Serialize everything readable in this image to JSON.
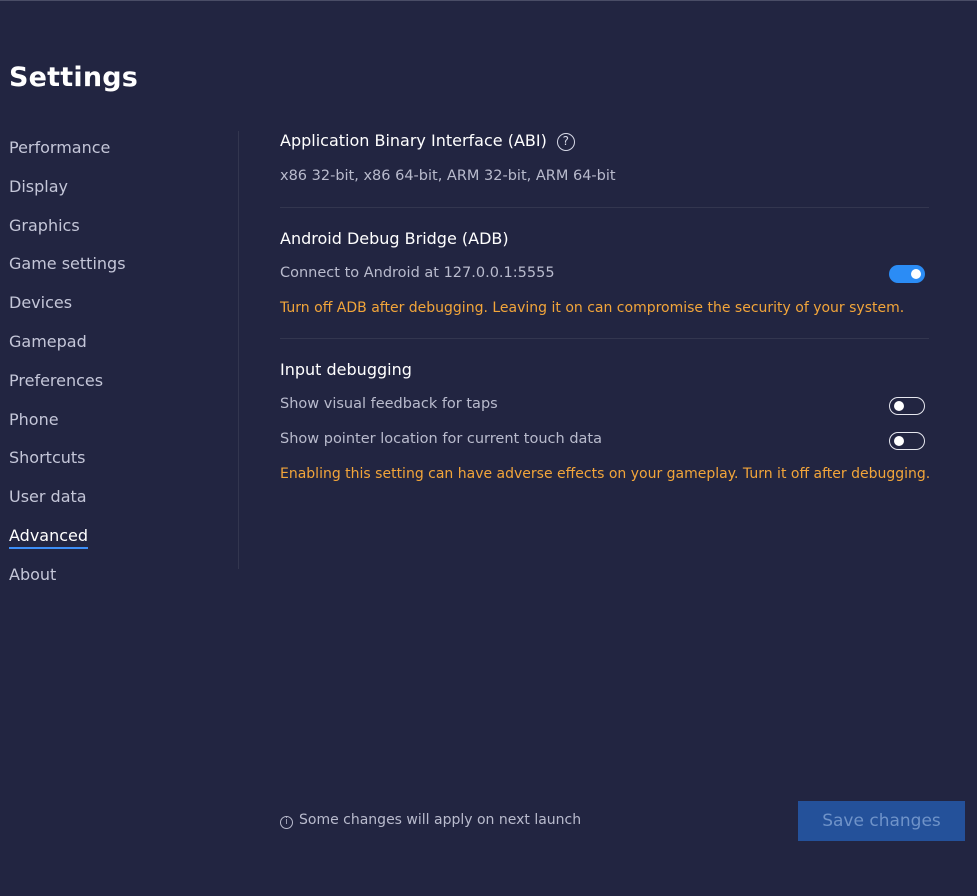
{
  "page": {
    "title": "Settings"
  },
  "sidebar": {
    "items": [
      {
        "label": "Performance"
      },
      {
        "label": "Display"
      },
      {
        "label": "Graphics"
      },
      {
        "label": "Game settings"
      },
      {
        "label": "Devices"
      },
      {
        "label": "Gamepad"
      },
      {
        "label": "Preferences"
      },
      {
        "label": "Phone"
      },
      {
        "label": "Shortcuts"
      },
      {
        "label": "User data"
      },
      {
        "label": "Advanced",
        "active": true
      },
      {
        "label": "About"
      }
    ]
  },
  "abi": {
    "title": "Application Binary Interface (ABI)",
    "help_icon": "?",
    "value": "x86 32-bit, x86 64-bit, ARM 32-bit, ARM 64-bit"
  },
  "adb": {
    "title": "Android Debug Bridge (ADB)",
    "connect_label": "Connect to Android at 127.0.0.1:5555",
    "connect_enabled": true,
    "warning": "Turn off ADB after debugging. Leaving it on can compromise the security of your system."
  },
  "input_debugging": {
    "title": "Input debugging",
    "taps_label": "Show visual feedback for taps",
    "taps_enabled": false,
    "pointer_label": "Show pointer location for current touch data",
    "pointer_enabled": false,
    "warning": "Enabling this setting can have adverse effects on your gameplay. Turn it off after debugging."
  },
  "footer": {
    "info_icon": "i",
    "note": "Some changes will apply on next launch",
    "save_label": "Save changes"
  },
  "colors": {
    "background": "#222541",
    "accent": "#2b8cf5",
    "warning": "#f2a53a",
    "save_button": "#24519a"
  }
}
